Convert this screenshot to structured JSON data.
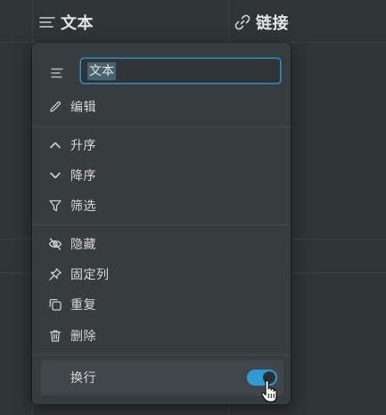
{
  "table": {
    "columns": [
      {
        "label": "文本",
        "icon": "text-lines-icon"
      },
      {
        "label": "链接",
        "icon": "link-icon"
      }
    ]
  },
  "popup": {
    "name_input": {
      "value": "文本",
      "icon": "text-lines-icon"
    },
    "items": [
      {
        "label": "编辑",
        "icon": "pencil-icon"
      },
      {
        "label": "升序",
        "icon": "chevron-up-icon"
      },
      {
        "label": "降序",
        "icon": "chevron-down-icon"
      },
      {
        "label": "筛选",
        "icon": "filter-icon"
      },
      {
        "label": "隐藏",
        "icon": "eye-off-icon"
      },
      {
        "label": "固定列",
        "icon": "pin-icon"
      },
      {
        "label": "重复",
        "icon": "duplicate-icon"
      },
      {
        "label": "删除",
        "icon": "trash-icon"
      }
    ],
    "wrap": {
      "label": "换行",
      "enabled": true
    }
  },
  "colors": {
    "background": "#2f3437",
    "popup": "#373c3f",
    "accent": "#2e9bd6"
  }
}
